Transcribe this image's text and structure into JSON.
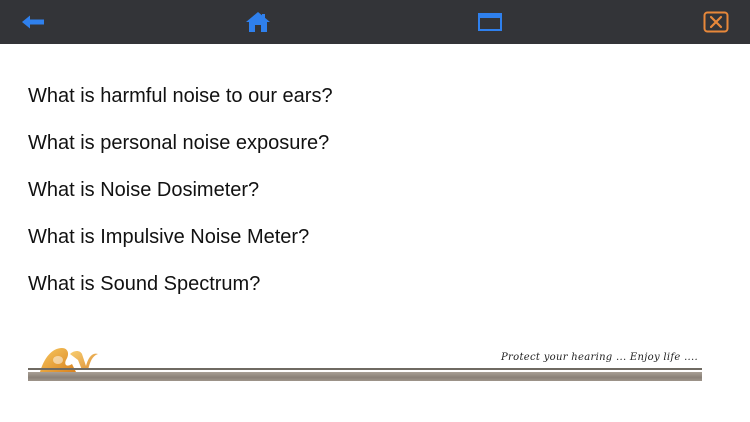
{
  "toolbar": {
    "back_icon": "back-arrow-icon",
    "home_icon": "home-icon",
    "window_icon": "window-icon",
    "close_icon": "close-x-icon",
    "colors": {
      "background": "#333438",
      "nav_icons": "#2f80ed",
      "close_icon": "#e8883a"
    }
  },
  "faq": {
    "items": [
      {
        "label": "What is harmful noise to our ears?"
      },
      {
        "label": "What is personal noise exposure?"
      },
      {
        "label": "What is Noise Dosimeter?"
      },
      {
        "label": "What is Impulsive Noise Meter?"
      },
      {
        "label": "What is Sound Spectrum?"
      }
    ]
  },
  "footer": {
    "logo_icon": "brand-logo-icon",
    "tagline": "Protect your hearing ... Enjoy life ...."
  }
}
